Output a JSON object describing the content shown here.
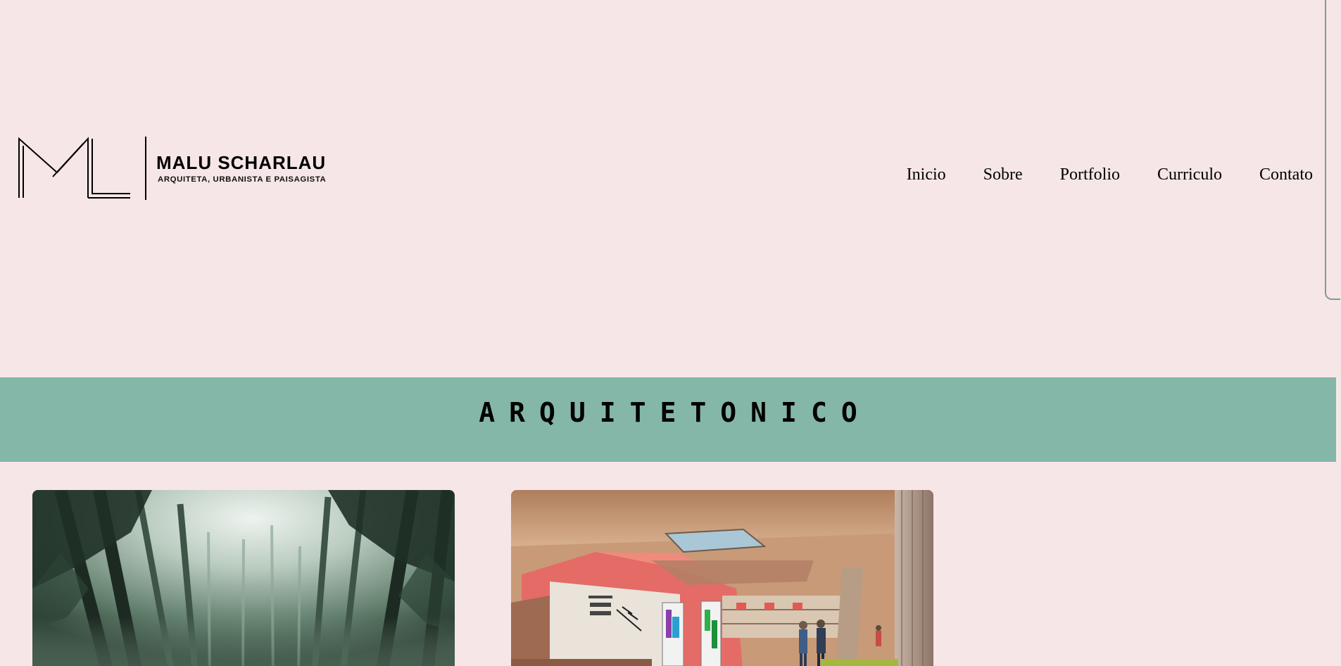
{
  "brand": {
    "name": "MALU SCHARLAU",
    "tagline": "ARQUITETA, URBANISTA E PAISAGISTA",
    "monogram_icon": "ml-monogram-icon"
  },
  "nav": {
    "items": [
      {
        "label": "Inicio"
      },
      {
        "label": "Sobre"
      },
      {
        "label": "Portfolio"
      },
      {
        "label": "Curriculo"
      },
      {
        "label": "Contato"
      }
    ]
  },
  "section": {
    "title": "ARQUITETONICO"
  },
  "colors": {
    "background": "#f6e6e7",
    "band": "#84b7a8",
    "text": "#000000"
  },
  "projects": [
    {
      "image": "forest-photo"
    },
    {
      "image": "station-interior-render"
    }
  ]
}
